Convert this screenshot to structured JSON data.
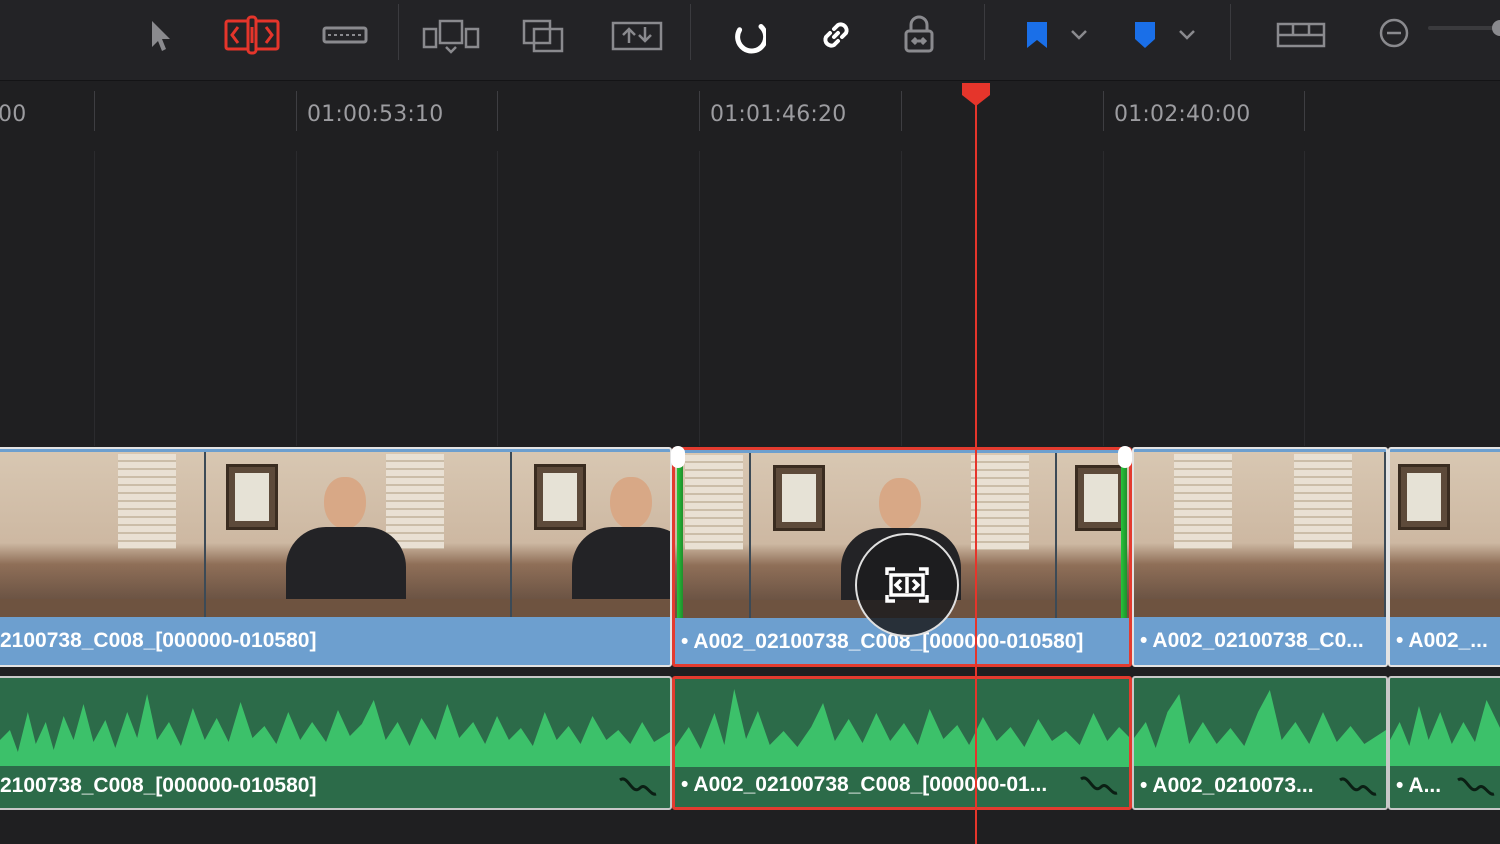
{
  "toolbar": {
    "tools": [
      {
        "name": "selection-mode",
        "icon": "arrow-pointer-icon"
      },
      {
        "name": "trim-edit-mode",
        "icon": "trim-icon",
        "active": true
      },
      {
        "name": "blade-edit-mode",
        "icon": "blade-icon"
      },
      {
        "name": "insert-clip",
        "icon": "insert-clip-icon"
      },
      {
        "name": "overwrite-clip",
        "icon": "overwrite-clip-icon"
      },
      {
        "name": "replace-clip",
        "icon": "replace-clip-icon"
      },
      {
        "name": "snapping",
        "icon": "magnet-icon"
      },
      {
        "name": "linked-selection",
        "icon": "link-icon"
      },
      {
        "name": "position-lock",
        "icon": "lock-icon"
      },
      {
        "name": "flag",
        "icon": "flag-icon"
      },
      {
        "name": "marker",
        "icon": "marker-icon"
      },
      {
        "name": "zoom-full",
        "icon": "full-extent-zoom-icon"
      },
      {
        "name": "zoom-out",
        "icon": "zoom-out-icon"
      }
    ],
    "accent_color": "#e5352b",
    "flag_color": "#1a6fe8"
  },
  "ruler": {
    "timecodes": [
      "00",
      "01:00:53:10",
      "01:01:46:20",
      "01:02:40:00"
    ]
  },
  "video_track": {
    "clips": [
      {
        "label": "2100738_C008_[000000-010580]"
      },
      {
        "label": "• A002_02100738_C008_[000000-010580]",
        "selected": true
      },
      {
        "label": "• A002_02100738_C0..."
      },
      {
        "label": "• A002_..."
      }
    ]
  },
  "audio_track": {
    "clips": [
      {
        "label": "2100738_C008_[000000-010580]"
      },
      {
        "label": "• A002_02100738_C008_[000000-01...",
        "selected": true
      },
      {
        "label": "• A002_0210073..."
      },
      {
        "label": "• A..."
      }
    ]
  },
  "colors": {
    "video_clip": "#6d9fcf",
    "audio_clip": "#2c6b49",
    "waveform": "#3cc16a",
    "playhead": "#e5352b",
    "selection": "#e33b2f"
  }
}
